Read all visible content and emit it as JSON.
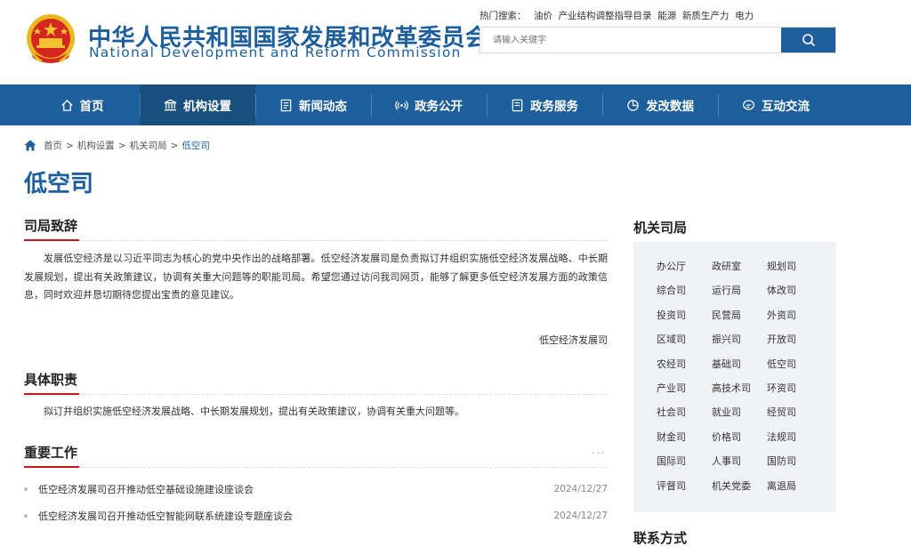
{
  "header": {
    "title_cn": "中华人民共和国国家发展和改革委员会",
    "title_en": "National Development and Reform Commission",
    "hot_label": "热门搜索：",
    "hot_terms": [
      "油价",
      "产业结构调整指导目录",
      "能源",
      "新质生产力",
      "电力"
    ],
    "search_placeholder": "请输入关键字"
  },
  "nav": {
    "items": [
      {
        "label": "首页",
        "icon": "home-icon"
      },
      {
        "label": "机构设置",
        "icon": "institution-icon"
      },
      {
        "label": "新闻动态",
        "icon": "news-icon"
      },
      {
        "label": "政务公开",
        "icon": "broadcast-icon"
      },
      {
        "label": "政务服务",
        "icon": "document-icon"
      },
      {
        "label": "发改数据",
        "icon": "pie-chart-icon"
      },
      {
        "label": "互动交流",
        "icon": "chat-icon"
      }
    ],
    "active_index": 1
  },
  "breadcrumb": [
    "首页",
    "机构设置",
    "机关司局",
    "低空司"
  ],
  "page_title": "低空司",
  "sections": {
    "message": {
      "title": "司局致辞",
      "text": "发展低空经济是以习近平同志为核心的党中央作出的战略部署。低空经济发展司是负责拟订并组织实施低空经济发展战略、中长期发展规划，提出有关政策建议，协调有关重大问题等的职能司局。希望您通过访问我司网页，能够了解更多低空经济发展方面的政策信息，同时欢迎并恳切期待您提出宝贵的意见建议。",
      "signature": "低空经济发展司"
    },
    "duties": {
      "title": "具体职责",
      "text": "拟订并组织实施低空经济发展战略、中长期发展规划，提出有关政策建议，协调有关重大问题等。"
    },
    "work": {
      "title": "重要工作",
      "more": "···",
      "items": [
        {
          "title": "低空经济发展司召开推动低空基础设施建设座谈会",
          "date": "2024/12/27"
        },
        {
          "title": "低空经济发展司召开推动低空智能网联系统建设专题座谈会",
          "date": "2024/12/27"
        }
      ]
    }
  },
  "sidebar": {
    "title": "机关司局",
    "departments": [
      "办公厅",
      "政研室",
      "规划司",
      "综合司",
      "运行局",
      "体改司",
      "投资司",
      "民营局",
      "外资司",
      "区域司",
      "振兴司",
      "开放司",
      "农经司",
      "基础司",
      "低空司",
      "产业司",
      "高技术司",
      "环资司",
      "社会司",
      "就业司",
      "经贸司",
      "财金司",
      "价格司",
      "法规司",
      "国际司",
      "人事司",
      "国防司",
      "评督司",
      "机关党委",
      "离退局"
    ],
    "next_title": "联系方式"
  },
  "colors": {
    "brand_blue": "#1d5e9c",
    "accent_red": "#c7161e",
    "side_bg": "#f0f2f5"
  }
}
